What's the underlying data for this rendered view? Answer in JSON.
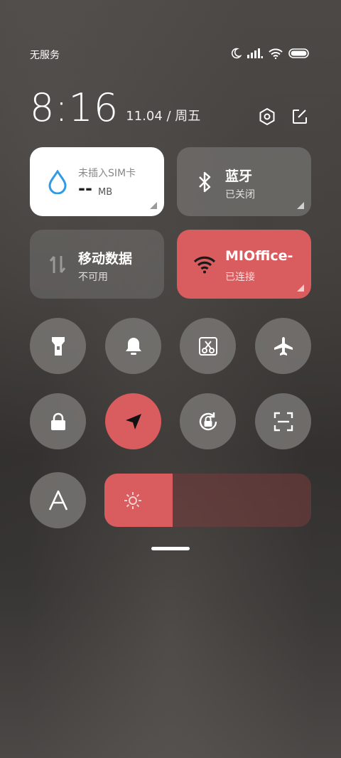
{
  "status": {
    "carrier": "无服务"
  },
  "clock": {
    "time": "8:16",
    "date": "11.04 / 周五"
  },
  "tiles": {
    "data_usage": {
      "line1": "未插入SIM卡",
      "value": "--",
      "unit": "MB"
    },
    "bluetooth": {
      "title": "蓝牙",
      "state": "已关闭"
    },
    "mobile_data": {
      "title": "移动数据",
      "state": "不可用"
    },
    "wifi": {
      "title": "MIOffice-",
      "state": "已连接"
    }
  },
  "toggles": [
    "flashlight",
    "silent",
    "screenshot",
    "airplane",
    "lock-screen",
    "location",
    "auto-rotate",
    "scanner",
    "font-size"
  ],
  "brightness": {
    "level": 0.33
  },
  "colors": {
    "accent": "#d95c5f",
    "tile_bg": "#6a6866",
    "white_tile": "#ffffff",
    "blue_icon": "#2f9ae6"
  }
}
